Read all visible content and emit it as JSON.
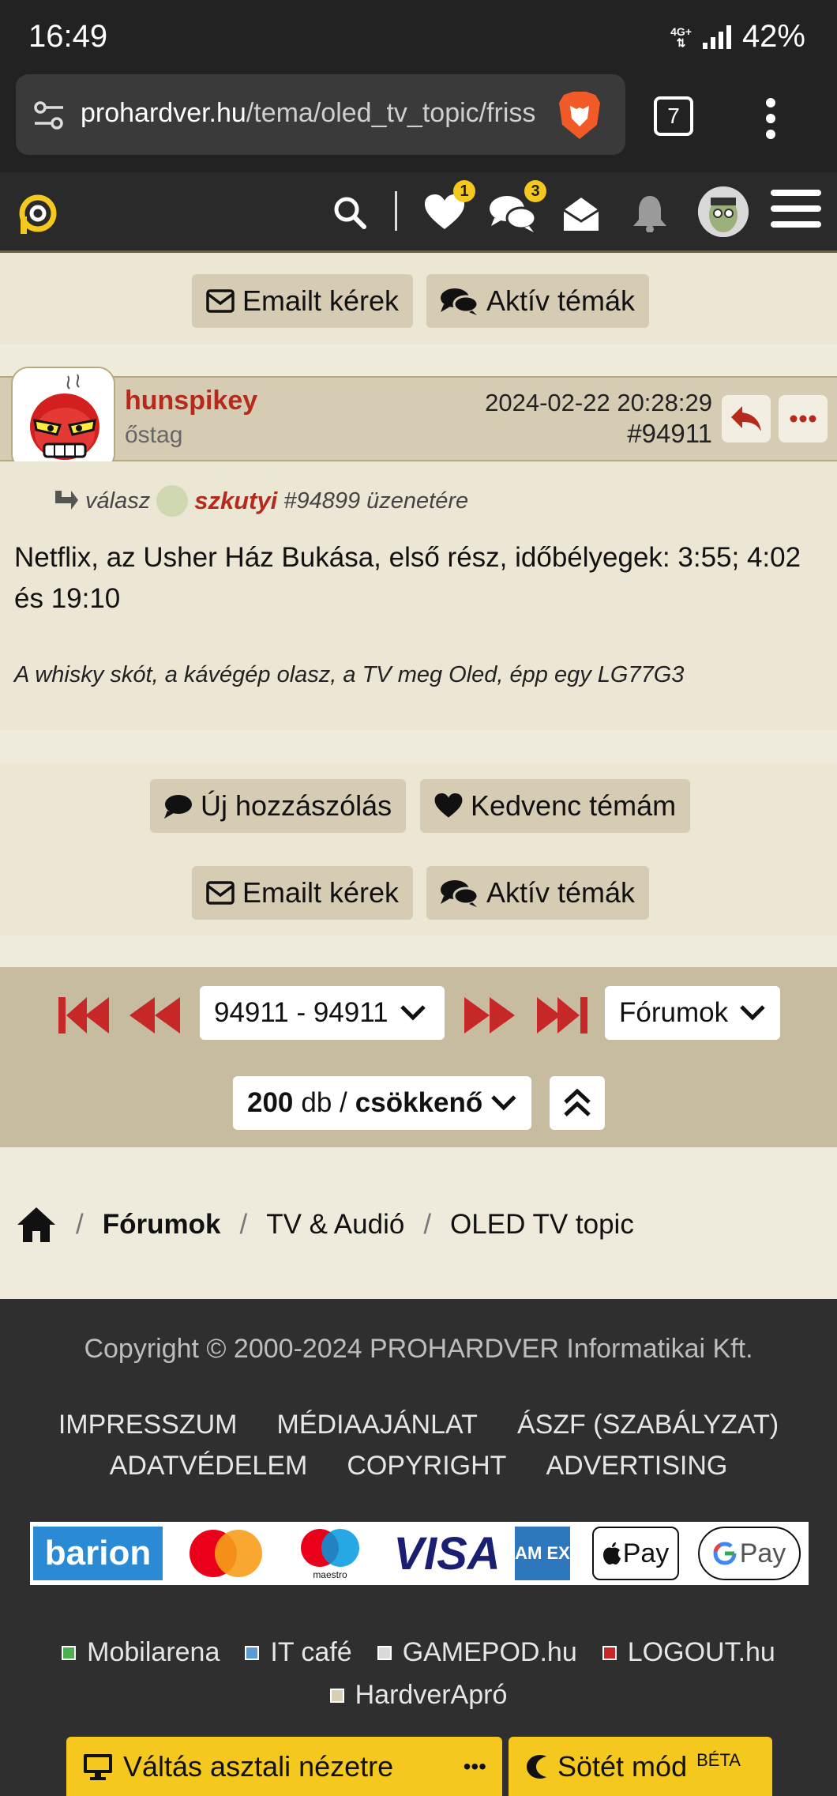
{
  "status_bar": {
    "time": "16:49",
    "network": "4G+",
    "battery": "42%"
  },
  "browser": {
    "url_host": "prohardver.hu",
    "url_path": "/tema/oled_tv_topic/friss",
    "tab_count": "7"
  },
  "header": {
    "favorites_badge": "1",
    "messages_badge": "3"
  },
  "top_actions": {
    "email_label": "Emailt kérek",
    "active_topics_label": "Aktív témák"
  },
  "post": {
    "author": "hunspikey",
    "rank": "őstag",
    "date": "2024-02-22 20:28:29",
    "number": "#94911",
    "reply_prefix": "válasz",
    "reply_to": "szkutyi",
    "reply_suffix": "#94899 üzenetére",
    "text": "Netflix, az Usher Ház Bukása, első rész, időbélyegek: 3:55; 4:02 és 19:10",
    "signature": "A whisky skót, a kávégép olasz, a TV meg Oled, épp egy LG77G3"
  },
  "bottom_actions": {
    "new_post_label": "Új hozzászólás",
    "favorite_topic_label": "Kedvenc témám",
    "email_label": "Emailt kérek",
    "active_topics_label": "Aktív témák"
  },
  "pager": {
    "range": "94911 - 94911",
    "forum_select": "Fórumok",
    "count": "200",
    "count_unit": "db /",
    "order": "csökkenő"
  },
  "breadcrumb": {
    "forums": "Fórumok",
    "category": "TV & Audió",
    "topic": "OLED TV topic"
  },
  "footer": {
    "copyright": "Copyright © 2000-2024 PROHARDVER Informatikai Kft.",
    "links_row1": [
      "IMPRESSZUM",
      "MÉDIAAJÁNLAT",
      "ÁSZF (SZABÁLYZAT)"
    ],
    "links_row2": [
      "ADATVÉDELEM",
      "COPYRIGHT",
      "ADVERTISING"
    ],
    "payments": {
      "barion": "barion",
      "maestro": "maestro",
      "visa": "VISA",
      "amex": "AM EX",
      "apple_pay": "Pay",
      "google_pay": "Pay"
    },
    "sites_row1": [
      {
        "label": "Mobilarena",
        "color": "#4caf50"
      },
      {
        "label": "IT café",
        "color": "#5b9bd5"
      },
      {
        "label": "GAMEPOD.hu",
        "color": "#d9d9d9"
      },
      {
        "label": "LOGOUT.hu",
        "color": "#c62828"
      }
    ],
    "sites_row2": [
      {
        "label": "HardverApró",
        "color": "#d8cfb4"
      }
    ],
    "desktop_view_label": "Váltás asztali nézetre",
    "more_label": "•••",
    "dark_mode_label": "Sötét mód",
    "dark_mode_sup": "BÉTA"
  },
  "colors": {
    "accent_red": "#b52a1c",
    "header_bg": "#2a2a2a",
    "tan": "#d6ccb3",
    "yellow": "#f4c81e"
  }
}
